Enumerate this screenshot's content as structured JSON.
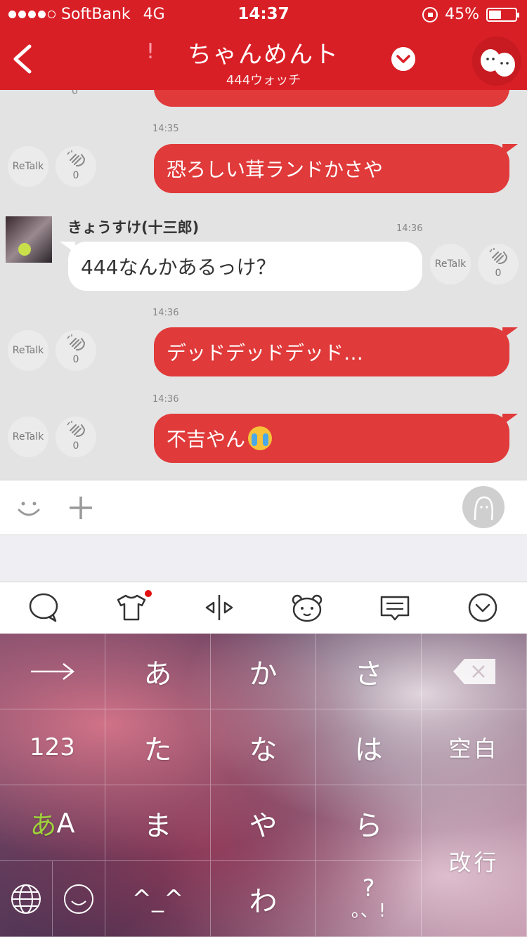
{
  "status_bar": {
    "carrier": "SoftBank",
    "network": "4G",
    "time": "14:37",
    "battery": "45%"
  },
  "header": {
    "title": "ちゃんめんト",
    "subtitle": "444ウォッチ",
    "exclaim": "!"
  },
  "messages": [
    {
      "type": "sent",
      "time": "14:35",
      "text": "恐ろしい茸ランドかさや",
      "retalk": "ReTalk",
      "claps": "0"
    },
    {
      "type": "received",
      "sender": "きょうすけ(十三郎)",
      "time": "14:36",
      "text": "444なんかあるっけ？",
      "retalk": "ReTalk",
      "claps": "0"
    },
    {
      "type": "sent",
      "time": "14:36",
      "text": "デッドデッドデッド…",
      "retalk": "ReTalk",
      "claps": "0"
    },
    {
      "type": "sent",
      "time": "14:36",
      "text": "不吉やん",
      "retalk": "ReTalk",
      "claps": "0"
    }
  ],
  "prev_claps": "0",
  "keyboard": {
    "row1": [
      "あ",
      "か",
      "さ"
    ],
    "row2": [
      "123",
      "た",
      "な",
      "は",
      "空白"
    ],
    "row3_left_a": "あ",
    "row3_left_b": "A",
    "row3": [
      "ま",
      "や",
      "ら"
    ],
    "row4": [
      "^_^",
      "わ",
      "?",
      "。、!"
    ],
    "enter": "改行"
  },
  "colors": {
    "brand_red": "#d91f26",
    "bubble_red": "#e03a3a",
    "keyboard_accent": "#9ed13b"
  }
}
